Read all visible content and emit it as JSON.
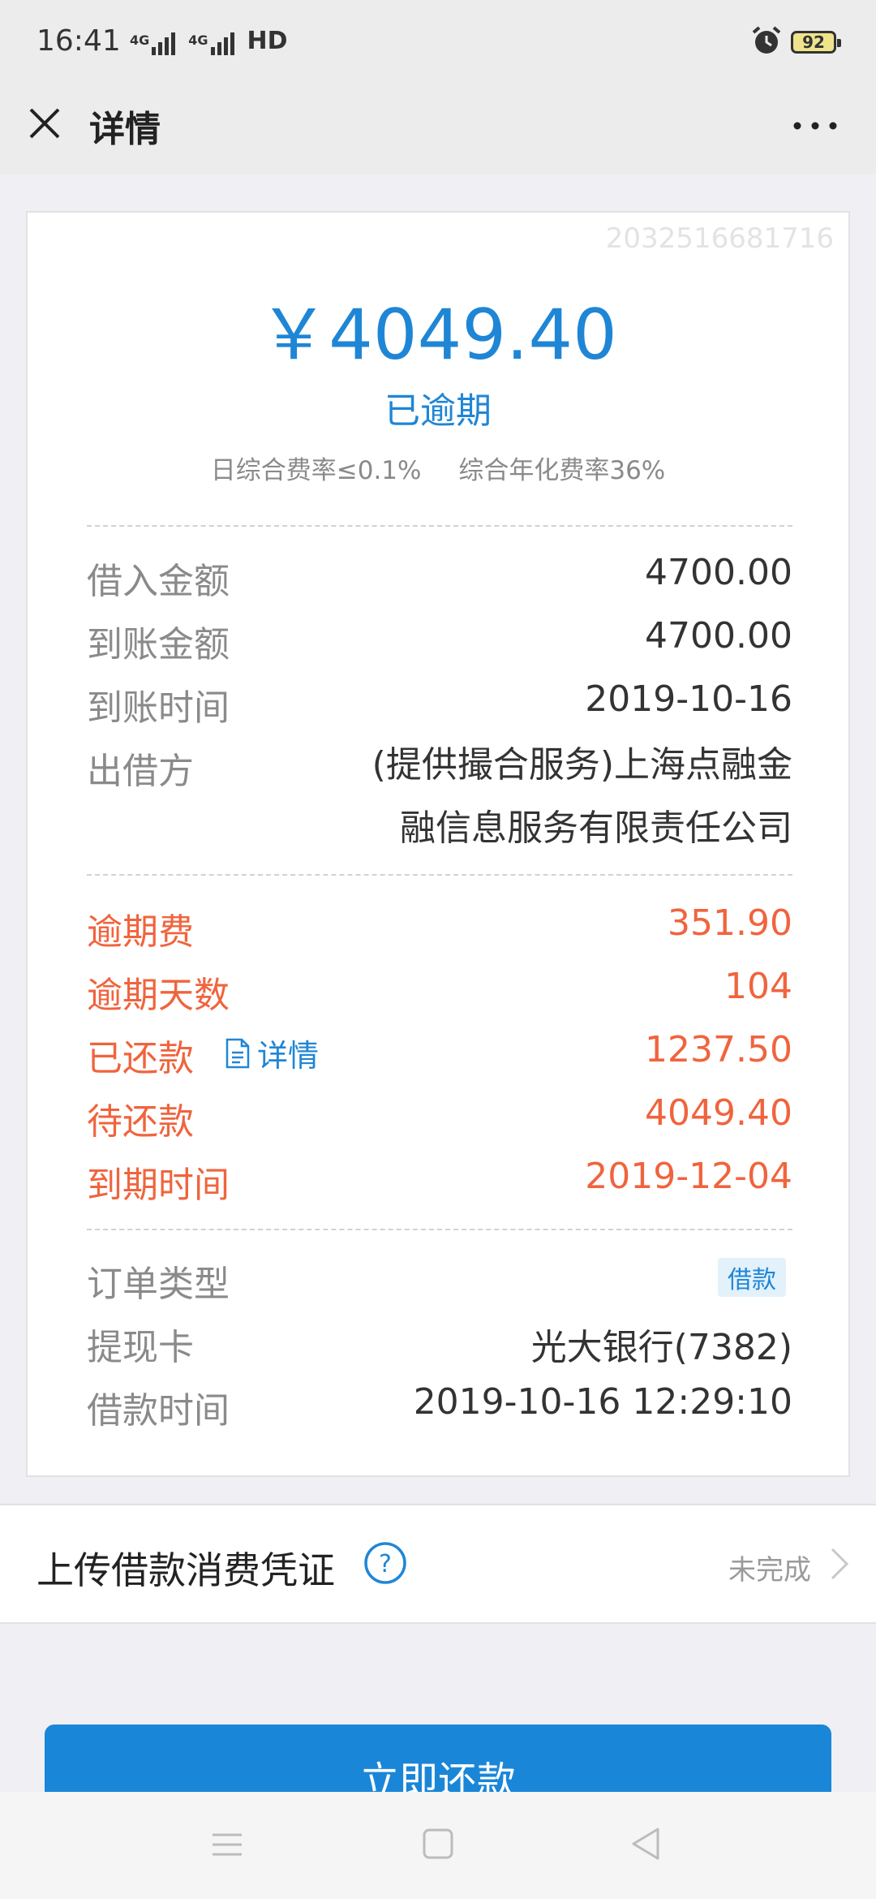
{
  "status_bar": {
    "time": "16:41",
    "network1": "4G",
    "network2": "4G",
    "hd": "HD",
    "battery": "92"
  },
  "header": {
    "title": "详情"
  },
  "summary": {
    "order_id": "2032516681716",
    "amount": "￥4049.40",
    "status": "已逾期",
    "daily_rate": "日综合费率≤0.1%",
    "annual_rate": "综合年化费率36%"
  },
  "loan_info": [
    {
      "label": "借入金额",
      "value": "4700.00"
    },
    {
      "label": "到账金额",
      "value": "4700.00"
    },
    {
      "label": "到账时间",
      "value": "2019-10-16"
    }
  ],
  "lender": {
    "label": "出借方",
    "line1": "(提供撮合服务)上海点融金",
    "line2": "融信息服务有限责任公司"
  },
  "repayment": {
    "overdue_fee": {
      "label": "逾期费",
      "value": "351.90"
    },
    "overdue_days": {
      "label": "逾期天数",
      "value": "104"
    },
    "repaid": {
      "label": "已还款",
      "link": "详情",
      "value": "1237.50"
    },
    "pending": {
      "label": "待还款",
      "value": "4049.40"
    },
    "due_date": {
      "label": "到期时间",
      "value": "2019-12-04"
    }
  },
  "order": {
    "type_label": "订单类型",
    "type_tag": "借款",
    "card_label": "提现卡",
    "card_value": "光大银行(7382)",
    "time_label": "借款时间",
    "time_value": "2019-10-16 12:29:10"
  },
  "upload": {
    "label": "上传借款消费凭证",
    "status": "未完成"
  },
  "repay_button": "立即还款",
  "colors": {
    "primary_blue": "#1f86d6",
    "overdue_red": "#f0643d",
    "label_gray": "#8a8a8a"
  }
}
